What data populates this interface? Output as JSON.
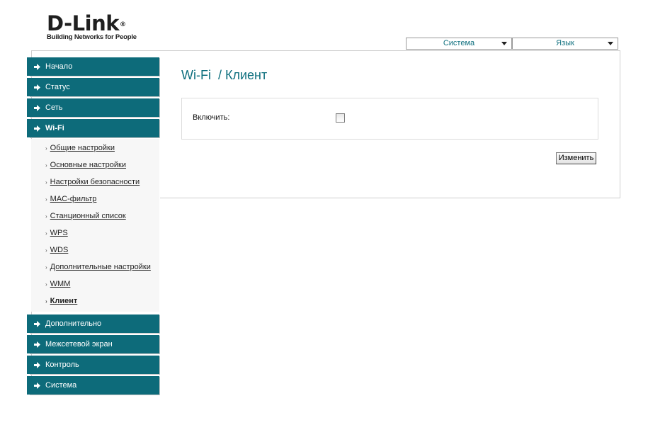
{
  "brand": {
    "name": "D-Link",
    "registered": "®",
    "tagline": "Building Networks for People"
  },
  "top": {
    "system": "Система",
    "language": "Язык"
  },
  "menu": [
    {
      "label": "Начало"
    },
    {
      "label": "Статус"
    },
    {
      "label": "Сеть"
    },
    {
      "label": "Wi-Fi",
      "active": true
    },
    {
      "label": "Дополнительно"
    },
    {
      "label": "Межсетевой экран"
    },
    {
      "label": "Контроль"
    },
    {
      "label": "Система"
    }
  ],
  "wifi_submenu": [
    {
      "label": "Общие настройки"
    },
    {
      "label": "Основные настройки"
    },
    {
      "label": "Настройки безопасности"
    },
    {
      "label": "MAC-фильтр"
    },
    {
      "label": "Станционный список"
    },
    {
      "label": "WPS"
    },
    {
      "label": "WDS"
    },
    {
      "label": "Дополнительные настройки"
    },
    {
      "label": "WMM"
    },
    {
      "label": "Клиент",
      "active": true
    }
  ],
  "content": {
    "title": "Wi-Fi  / Клиент",
    "enable_label": "Включить:",
    "enabled": false,
    "change_button": "Изменить"
  },
  "colors": {
    "accent": "#0d6b7a",
    "title": "#0e6f7e"
  }
}
